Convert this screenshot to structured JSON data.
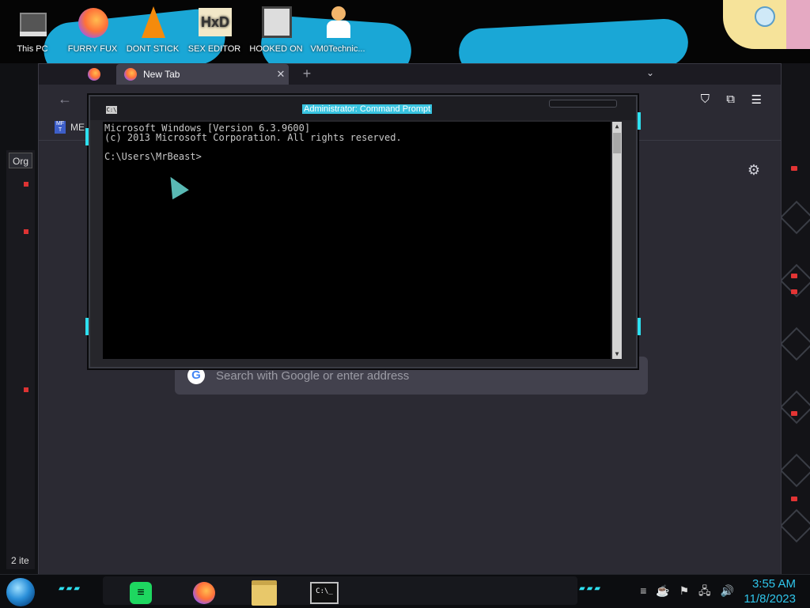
{
  "desktop": {
    "icons": [
      {
        "label": "This PC"
      },
      {
        "label": "FURRY FUX"
      },
      {
        "label": "DONT STICK"
      },
      {
        "label": "SEX EDITOR"
      },
      {
        "label": "HOOKED ON"
      },
      {
        "label": "VM0Technic..."
      }
    ]
  },
  "browser": {
    "tab_label": "New Tab",
    "new_tab_symbol": "+",
    "close_symbol": "✕",
    "back_symbol": "←",
    "tablist_symbol": "⌄",
    "bookmark_label": "ME",
    "bookmark_icon_text": "MF T",
    "search_placeholder": "Search with Google or enter address",
    "google_letter": "G",
    "gear_symbol": "⚙"
  },
  "explorer": {
    "organize_label": "Org",
    "items_count": "2 ite"
  },
  "cmd": {
    "title": "Administrator: Command Prompt",
    "sysicon": "C:\\",
    "lines": [
      "Microsoft Windows [Version 6.3.9600]",
      "(c) 2013 Microsoft Corporation. All rights reserved.",
      "",
      "C:\\Users\\MrBeast>"
    ]
  },
  "taskbar": {
    "cmd_icon_text": "C:\\_",
    "clock_time": "3:55 AM",
    "clock_date": "11/8/2023"
  },
  "colors": {
    "accent_cyan": "#2ee0f0",
    "clock": "#2fc6ec",
    "title_highlight": "#38c4e0"
  }
}
